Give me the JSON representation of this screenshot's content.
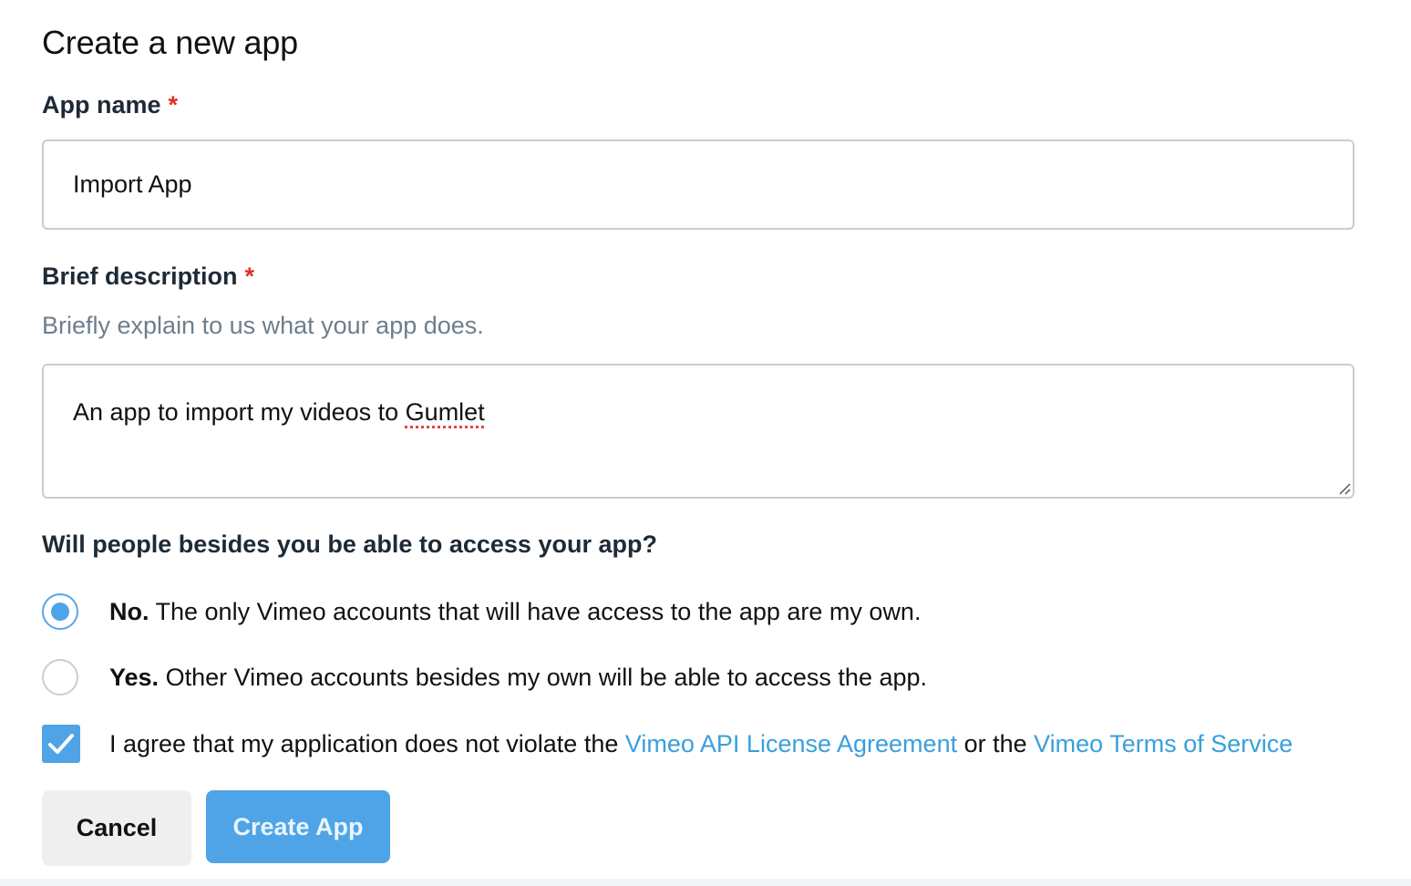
{
  "form": {
    "title": "Create a new app",
    "app_name": {
      "label": "App name",
      "required_mark": "*",
      "value": "Import App"
    },
    "description": {
      "label": "Brief description",
      "required_mark": "*",
      "help": "Briefly explain to us what your app does.",
      "value_prefix": "An app to import my videos to ",
      "value_misspelled": "Gumlet"
    },
    "access": {
      "question": "Will people besides you be able to access your app?",
      "selected": "no",
      "options": [
        {
          "bold": "No.",
          "text": " The only Vimeo accounts that will have access to the app are my own."
        },
        {
          "bold": "Yes.",
          "text": " Other Vimeo accounts besides my own will be able to access the app."
        }
      ]
    },
    "agreement": {
      "checked": true,
      "text_before": "I agree that my application does not violate the ",
      "link1": "Vimeo API License Agreement",
      "text_middle": " or the ",
      "link2": "Vimeo Terms of Service"
    },
    "buttons": {
      "cancel": "Cancel",
      "create": "Create App"
    }
  },
  "colors": {
    "accent": "#4ea4e6",
    "link": "#3a9fdc",
    "required": "#d93025",
    "help_text": "#6f7e8c"
  },
  "icons": [
    "checkmark-icon",
    "resize-handle-icon"
  ]
}
